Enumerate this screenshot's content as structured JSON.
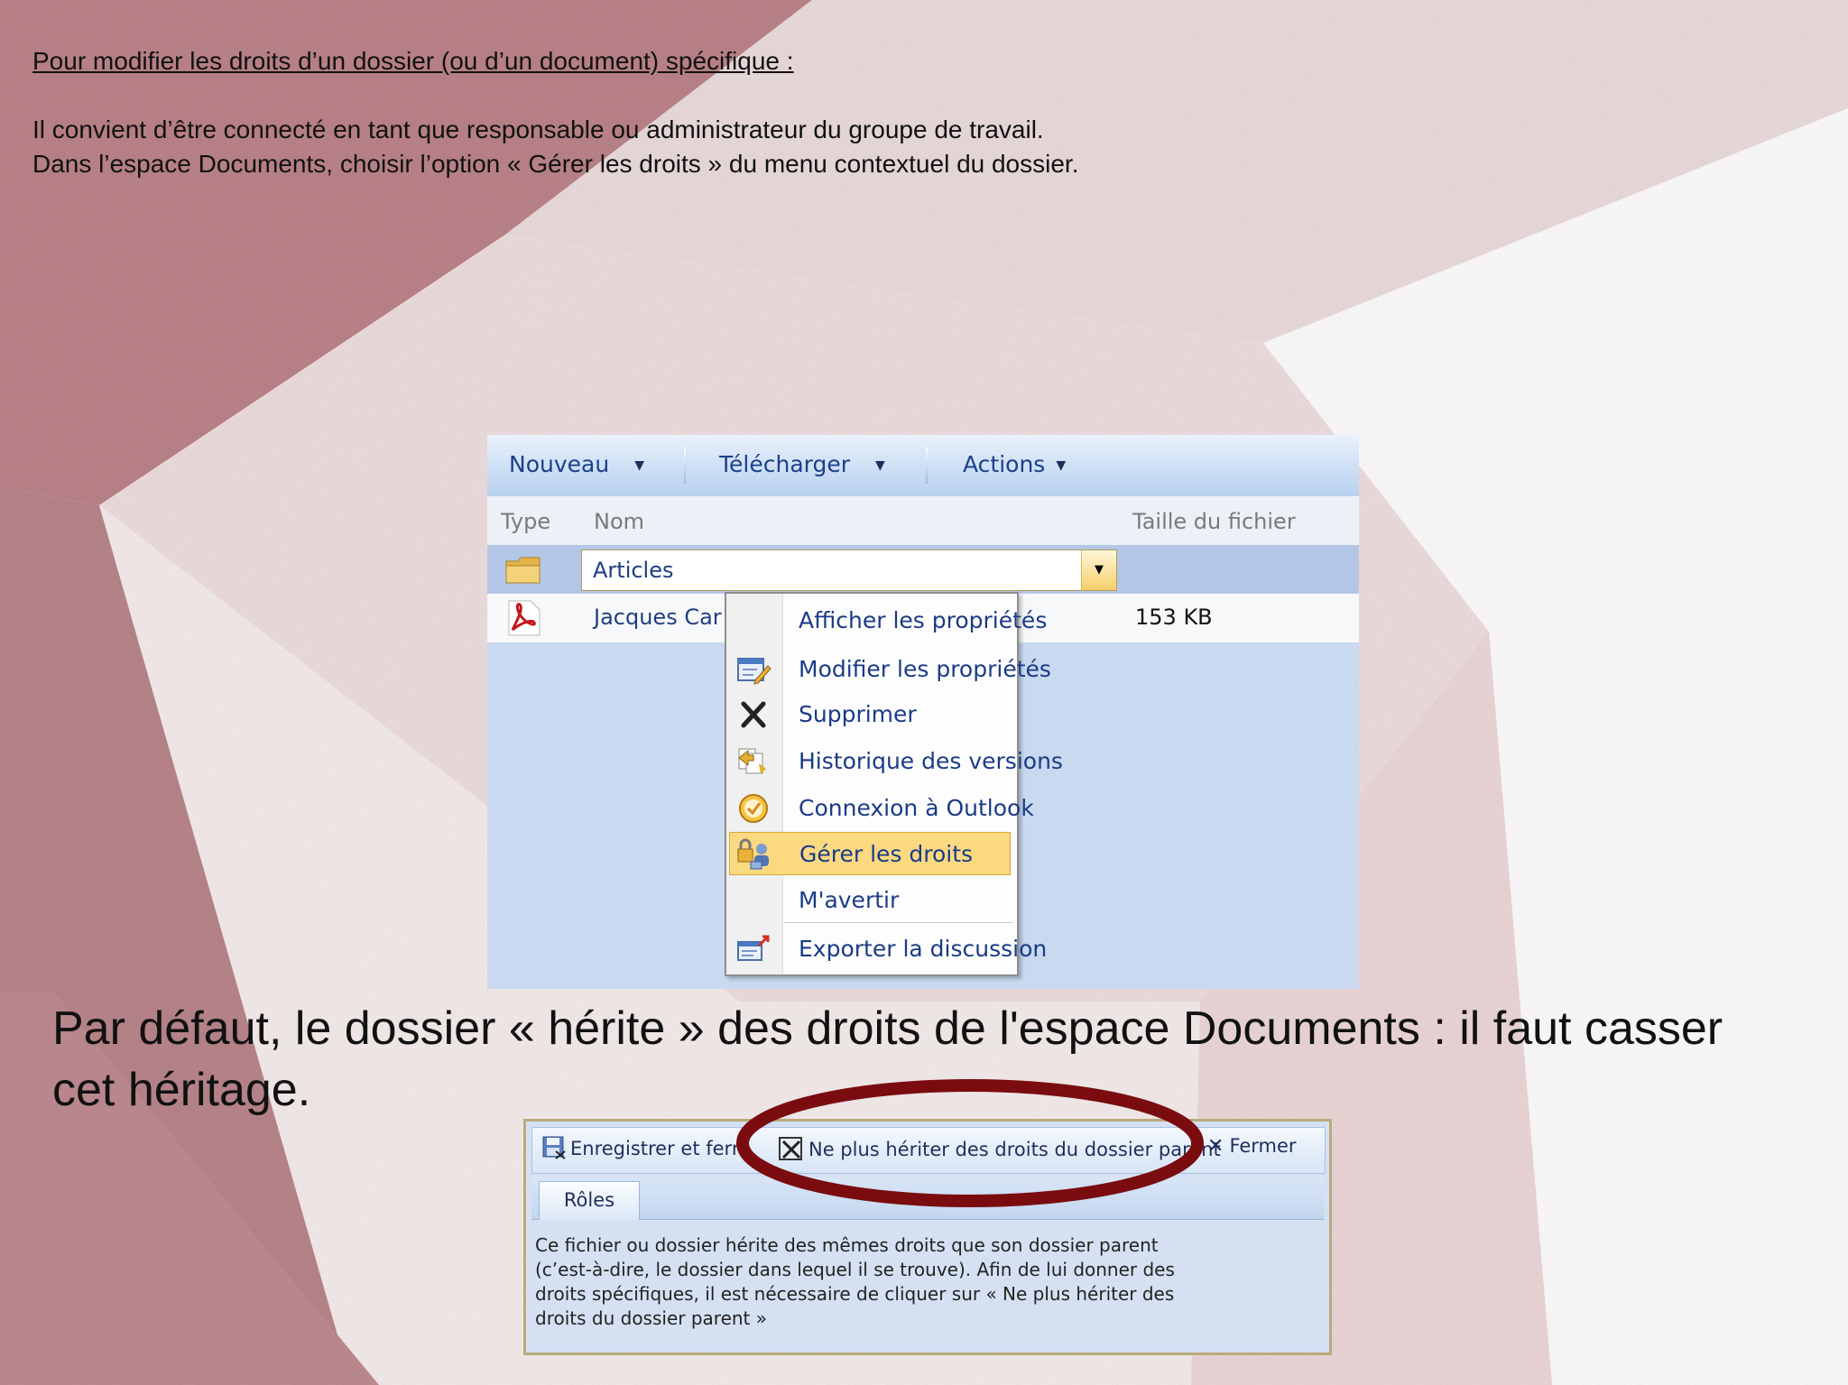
{
  "doc": {
    "heading": "Pour modifier les droits d’un dossier (ou d’un document) spécifique :",
    "intro_line1": "Il convient d’être connecté en tant que responsable ou administrateur du groupe de travail.",
    "intro_line2": "Dans l’espace Documents, choisir l’option « Gérer les droits » du menu contextuel du dossier.",
    "paragraph": "Par défaut, le dossier « hérite » des droits de l'espace Documents : il faut casser cet héritage."
  },
  "library": {
    "toolbar": {
      "new_label": "Nouveau",
      "upload_label": "Télécharger",
      "actions_label": "Actions"
    },
    "columns": {
      "type": "Type",
      "name": "Nom",
      "size": "Taille du fichier"
    },
    "rows": [
      {
        "name": "Articles",
        "icon": "folder-icon",
        "size": ""
      },
      {
        "name": "Jacques Car",
        "icon": "pdf-icon",
        "size": "153 KB"
      }
    ],
    "context_menu": {
      "items": [
        {
          "label": "Afficher les propriétés",
          "icon": ""
        },
        {
          "label": "Modifier les propriétés",
          "icon": "edit-properties-icon"
        },
        {
          "label": "Supprimer",
          "icon": "delete-x-icon"
        },
        {
          "label": "Historique des versions",
          "icon": "version-history-icon"
        },
        {
          "label": "Connexion à Outlook",
          "icon": "outlook-icon"
        },
        {
          "label": "Gérer les droits",
          "icon": "manage-permissions-icon",
          "highlighted": true
        },
        {
          "label": "M'avertir",
          "icon": ""
        },
        {
          "label": "Exporter la discussion",
          "icon": "export-icon"
        }
      ]
    }
  },
  "permissions": {
    "toolbar": {
      "save_close": "Enregistrer et ferm",
      "stop_inherit": "Ne plus hériter des droits du dossier parent",
      "close": "Fermer"
    },
    "tab_roles": "Rôles",
    "description_lines": [
      "Ce fichier ou dossier hérite des mêmes droits que son dossier parent",
      "(c’est-à-dire, le dossier dans lequel il se trouve). Afin de lui donner des",
      "droits spécifiques, il est nécessaire de cliquer sur « Ne plus hériter  des",
      "droits du dossier parent »"
    ],
    "highlight_color": "#7a0c10"
  }
}
